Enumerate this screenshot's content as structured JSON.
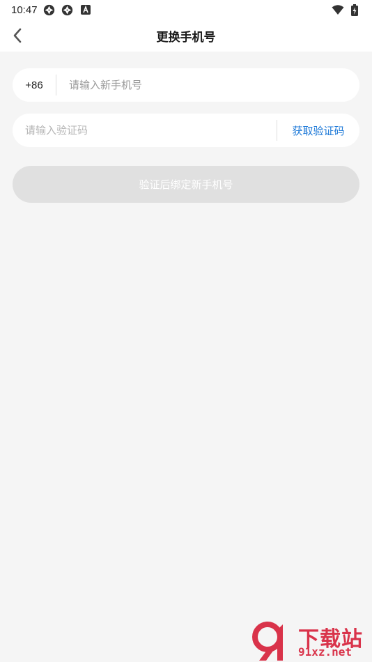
{
  "status_bar": {
    "time": "10:47",
    "left_icons": [
      "aperture-icon",
      "aperture-icon",
      "a-badge-icon"
    ],
    "right_icons": [
      "wifi-icon",
      "battery-icon"
    ]
  },
  "header": {
    "title": "更换手机号",
    "back_icon": "chevron-left-icon"
  },
  "phone_field": {
    "prefix": "+86",
    "value": "",
    "placeholder": "请输入新手机号"
  },
  "code_field": {
    "value": "",
    "placeholder": "请输入验证码",
    "get_code_label": "获取验证码"
  },
  "submit_button": {
    "label": "验证后绑定新手机号",
    "enabled": false
  },
  "watermark": {
    "title": "下载站",
    "domain": "91xz.net"
  },
  "colors": {
    "background": "#f5f5f5",
    "surface": "#ffffff",
    "accent": "#1f7ad8",
    "disabled_button": "#e0e0e0",
    "watermark": "#d9334a"
  }
}
